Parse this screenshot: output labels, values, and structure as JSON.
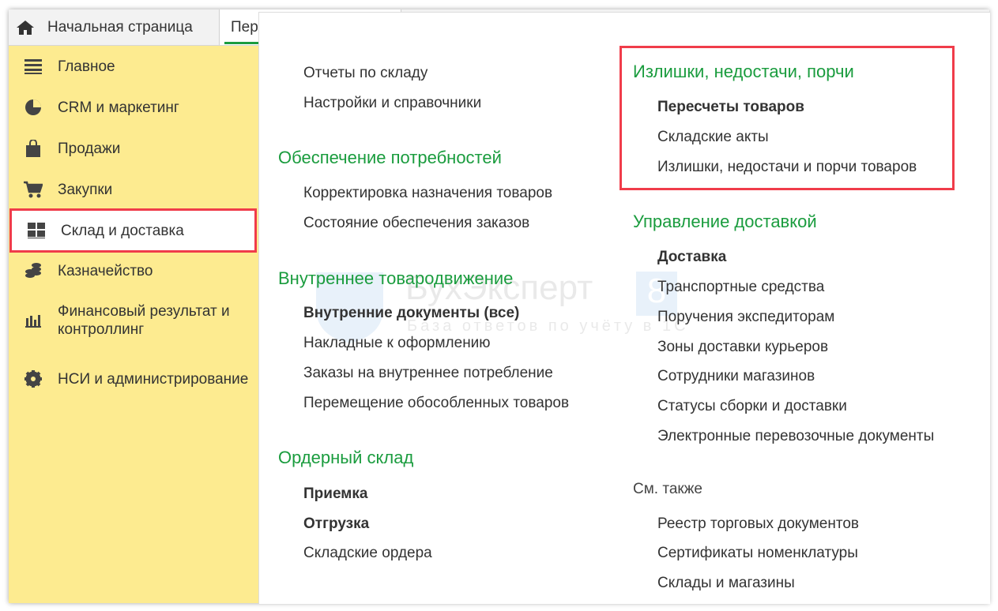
{
  "tabs": [
    {
      "label": "Начальная страница",
      "icon": "home-icon"
    },
    {
      "label": "Пер"
    }
  ],
  "sidebar": {
    "items": [
      {
        "label": "Главное",
        "icon": "menu-icon"
      },
      {
        "label": "CRM и маркетинг",
        "icon": "pie-chart-icon"
      },
      {
        "label": "Продажи",
        "icon": "shopping-bag-icon"
      },
      {
        "label": "Закупки",
        "icon": "cart-icon"
      },
      {
        "label": "Склад и доставка",
        "icon": "warehouse-icon",
        "active": true
      },
      {
        "label": "Казначейство",
        "icon": "coins-icon"
      },
      {
        "label": "Финансовый результат и контроллинг",
        "icon": "bar-chart-icon"
      },
      {
        "label": "НСИ и администрирование",
        "icon": "gear-icon"
      }
    ]
  },
  "panel": {
    "left": {
      "top_links": [
        "Отчеты по складу",
        "Настройки и справочники"
      ],
      "sections": [
        {
          "title": "Обеспечение потребностей",
          "items": [
            "Корректировка назначения товаров",
            "Состояние обеспечения заказов"
          ]
        },
        {
          "title": "Внутреннее товародвижение",
          "items": [
            "Внутренние документы (все)",
            "Накладные к оформлению",
            "Заказы на внутреннее потребление",
            "Перемещение обособленных товаров"
          ]
        },
        {
          "title": "Ордерный склад",
          "items": [
            "Приемка",
            "Отгрузка",
            "Складские ордера"
          ]
        }
      ]
    },
    "right": {
      "sections": [
        {
          "title": "Излишки, недостачи, порчи",
          "items": [
            "Пересчеты товаров",
            "Складские акты",
            "Излишки, недостачи и порчи товаров"
          ]
        },
        {
          "title": "Управление доставкой",
          "items": [
            "Доставка",
            "Транспортные средства",
            "Поручения экспедиторам",
            "Зоны доставки курьеров",
            "Сотрудники магазинов",
            "Статусы сборки и доставки",
            "Электронные перевозочные документы"
          ]
        }
      ],
      "see_also": {
        "title": "См. также",
        "items": [
          "Реестр торговых документов",
          "Сертификаты номенклатуры",
          "Склады и магазины"
        ]
      }
    }
  },
  "watermark": {
    "brand": "БухЭксперт",
    "badge": "8",
    "tagline": "База ответов по учёту в 1С"
  },
  "colors": {
    "accent": "#1a9c3e",
    "sidebar": "#fdeb90",
    "highlight": "#f03c4a"
  }
}
